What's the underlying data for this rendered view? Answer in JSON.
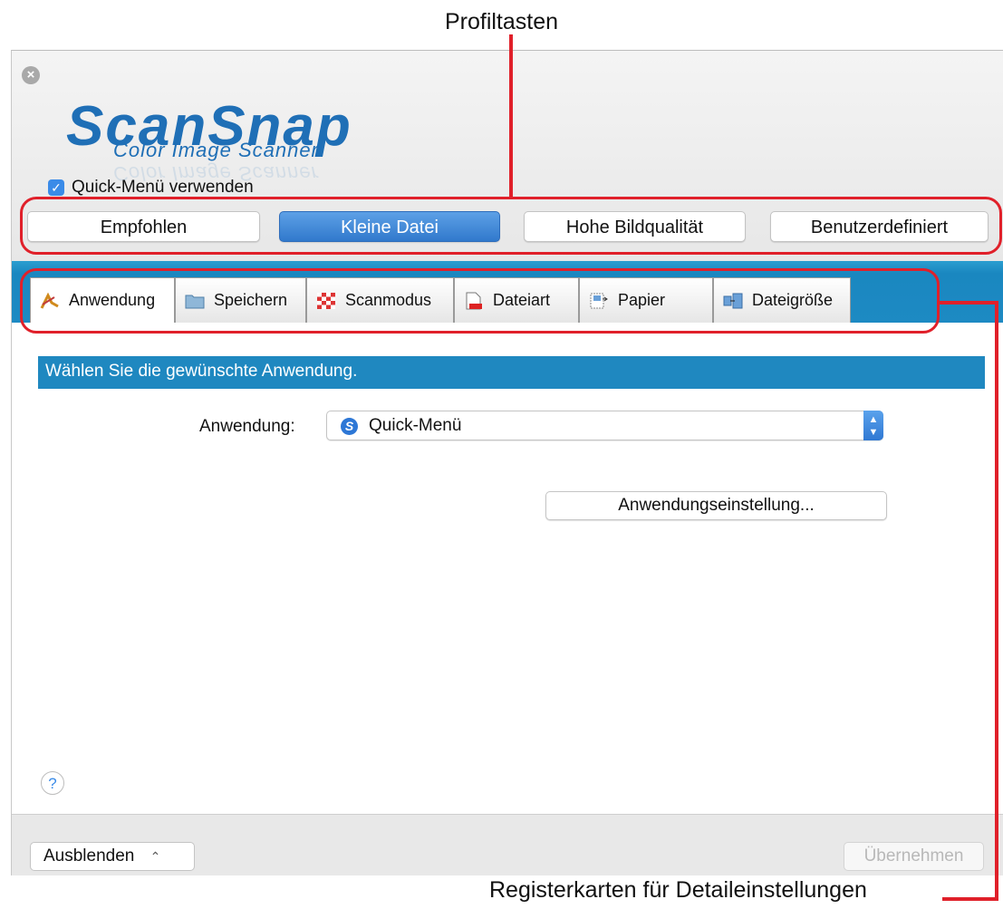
{
  "callouts": {
    "profile_buttons": "Profiltasten",
    "detail_tabs": "Registerkarten für Detaileinstellungen"
  },
  "header": {
    "logo": "ScanSnap",
    "logo_subtitle": "Color Image Scanner",
    "quick_menu_label": "Quick-Menü verwenden",
    "quick_menu_checked": true
  },
  "profiles": [
    {
      "label": "Empfohlen",
      "active": false
    },
    {
      "label": "Kleine Datei",
      "active": true
    },
    {
      "label": "Hohe Bildqualität",
      "active": false
    },
    {
      "label": "Benutzerdefiniert",
      "active": false
    }
  ],
  "tabs": [
    {
      "label": "Anwendung",
      "icon": "application-icon",
      "selected": true
    },
    {
      "label": "Speichern",
      "icon": "folder-icon",
      "selected": false
    },
    {
      "label": "Scanmodus",
      "icon": "scan-mode-icon",
      "selected": false
    },
    {
      "label": "Dateiart",
      "icon": "file-type-icon",
      "selected": false
    },
    {
      "label": "Papier",
      "icon": "paper-icon",
      "selected": false
    },
    {
      "label": "Dateigröße",
      "icon": "file-size-icon",
      "selected": false
    }
  ],
  "main": {
    "section_title": "Wählen Sie die gewünschte Anwendung.",
    "app_label": "Anwendung:",
    "app_value": "Quick-Menü",
    "app_settings_button": "Anwendungseinstellung..."
  },
  "footer": {
    "hide_button": "Ausblenden",
    "apply_button": "Übernehmen",
    "help": "?"
  },
  "colors": {
    "accent_blue": "#1f88c0",
    "active_button": "#3179cc",
    "annotation_red": "#e0202a"
  }
}
